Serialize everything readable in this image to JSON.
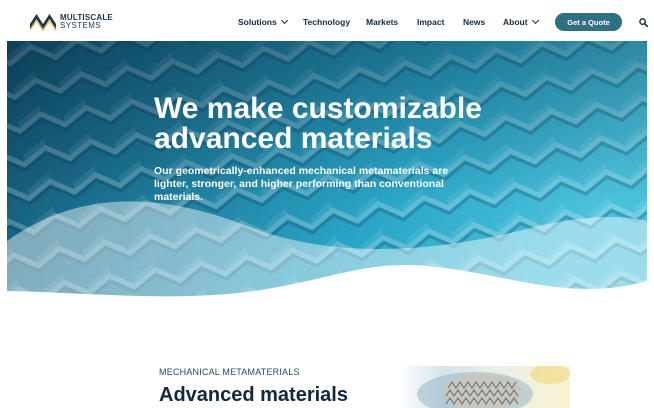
{
  "brand": {
    "line1": "MULTISCALE",
    "line2": "SYSTEMS",
    "colors": {
      "navy": "#1d3550",
      "gold": "#e9b83a",
      "teal": "#2f7184"
    }
  },
  "nav": {
    "items": [
      {
        "label": "Solutions",
        "has_dropdown": true
      },
      {
        "label": "Technology",
        "has_dropdown": false
      },
      {
        "label": "Markets",
        "has_dropdown": false
      },
      {
        "label": "Impact",
        "has_dropdown": false
      },
      {
        "label": "News",
        "has_dropdown": false
      },
      {
        "label": "About",
        "has_dropdown": true
      }
    ],
    "cta_label": "Get a Quote",
    "search_icon": "search-icon"
  },
  "hero": {
    "title": "We make customizable advanced materials",
    "subtitle": "Our geometrically-enhanced mechanical metamaterials are lighter, stronger, and higher performing than conventional materials."
  },
  "section": {
    "eyebrow": "MECHANICAL METAMATERIALS",
    "title": "Advanced materials"
  }
}
